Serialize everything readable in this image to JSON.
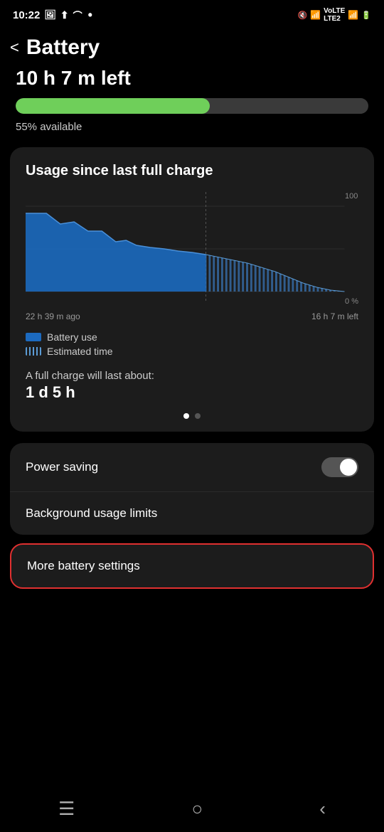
{
  "statusBar": {
    "time": "10:22",
    "icons": [
      "photo",
      "upload",
      "wifi",
      "signal"
    ],
    "batteryIcon": "battery"
  },
  "header": {
    "backLabel": "<",
    "title": "Battery"
  },
  "batteryDisplay": {
    "text": "10 h 7 m left",
    "partialVisible": "10 h 7 m"
  },
  "batteryBar": {
    "percent": 55,
    "fillColor": "#6fcf5a",
    "bgColor": "#3a3a3a"
  },
  "availableText": "55% available",
  "usageCard": {
    "title": "Usage since last full charge",
    "chart": {
      "leftLabel": "22 h 39 m ago",
      "rightLabel": "16 h 7 m left",
      "yTop": "100",
      "yBottom": "0 %"
    },
    "legend": [
      {
        "type": "solid",
        "label": "Battery use"
      },
      {
        "type": "striped",
        "label": "Estimated time"
      }
    ],
    "fullChargeLabel": "A full charge will last about:",
    "fullChargeValue": "1 d 5 h",
    "pageDots": [
      true,
      false
    ]
  },
  "settings": [
    {
      "label": "Power saving",
      "hasToggle": true,
      "toggleOn": false
    },
    {
      "label": "Background usage limits",
      "hasToggle": false
    }
  ],
  "moreSettings": {
    "label": "More battery settings",
    "highlighted": true
  },
  "navBar": {
    "items": [
      "menu",
      "home",
      "back"
    ]
  }
}
